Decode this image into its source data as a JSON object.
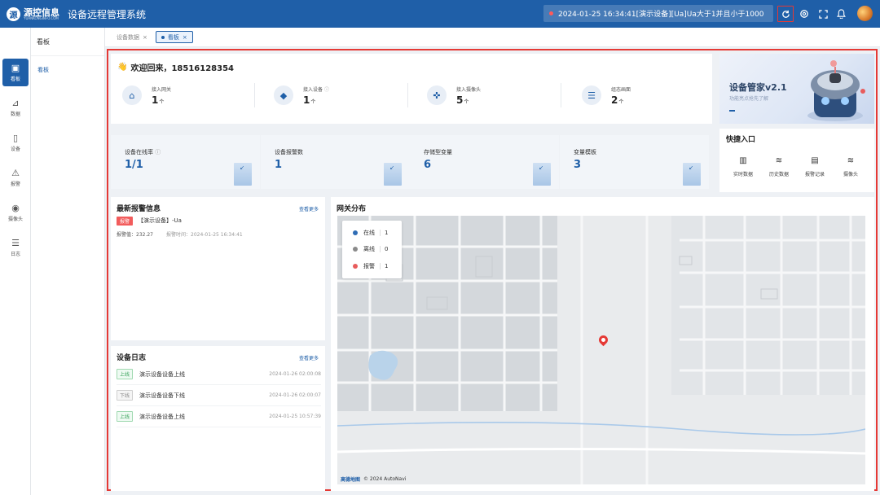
{
  "header": {
    "logo_mark": "源",
    "logo_main": "源控信息",
    "logo_sub": "YUANKONGINFO.COM",
    "app_title": "设备远程管理系统",
    "alarm_ticker": "2024-01-25 16:34:41[演示设备][Ua]Ua大于1并且小于1000",
    "icons": [
      "refresh-icon",
      "settings-icon",
      "fullscreen-icon",
      "bell-icon"
    ]
  },
  "sidebar": {
    "items": [
      {
        "label": "看板",
        "icon": "dashboard-icon",
        "active": true
      },
      {
        "label": "数据",
        "icon": "chart-icon"
      },
      {
        "label": "设备",
        "icon": "device-icon"
      },
      {
        "label": "报警",
        "icon": "alarm-icon"
      },
      {
        "label": "摄像头",
        "icon": "camera-icon"
      },
      {
        "label": "日志",
        "icon": "log-icon"
      }
    ]
  },
  "subnav": {
    "title": "看板",
    "items": [
      "看板"
    ]
  },
  "tabs": [
    {
      "label": "设备数据"
    },
    {
      "label": "看板",
      "active": true
    }
  ],
  "welcome": {
    "title": "欢迎回来，18516128354",
    "stats": [
      {
        "label": "接入网关",
        "value": "1",
        "unit": "个"
      },
      {
        "label": "接入设备",
        "value": "1",
        "unit": "个"
      },
      {
        "label": "接入摄像头",
        "value": "5",
        "unit": "个"
      },
      {
        "label": "组态画面",
        "value": "2",
        "unit": "个"
      }
    ]
  },
  "banner": {
    "title": "设备管家v2.1",
    "subtitle": "功能亮点抢先了解"
  },
  "kpis": [
    {
      "label": "设备在线率",
      "value": "1/1"
    },
    {
      "label": "设备报警数",
      "value": "1"
    },
    {
      "label": "存储型变量",
      "value": "6"
    },
    {
      "label": "变量模板",
      "value": "3"
    }
  ],
  "quick_entry": {
    "title": "快捷入口",
    "items": [
      {
        "label": "实时数据",
        "icon": "bar-chart-icon"
      },
      {
        "label": "历史数据",
        "icon": "layers-icon"
      },
      {
        "label": "报警记录",
        "icon": "report-icon"
      },
      {
        "label": "摄像头",
        "icon": "layers-icon"
      }
    ]
  },
  "alarms": {
    "title": "最新报警信息",
    "more": "查看更多",
    "items": [
      {
        "badge": "报警",
        "device": "【演示设备】-Ua",
        "value_text": "报警值：232.27",
        "time_text": "报警时间：2024-01-25 16:34:41"
      }
    ]
  },
  "logs": {
    "title": "设备日志",
    "more": "查看更多",
    "items": [
      {
        "status": "上线",
        "message": "演示设备设备上线",
        "time": "2024-01-26 02:00:08",
        "type": "online"
      },
      {
        "status": "下线",
        "message": "演示设备设备下线",
        "time": "2024-01-26 02:00:07",
        "type": "offline"
      },
      {
        "status": "上线",
        "message": "演示设备设备上线",
        "time": "2024-01-25 10:57:39",
        "type": "online"
      }
    ]
  },
  "map": {
    "title": "网关分布",
    "legend": [
      {
        "label": "在线",
        "count": "1",
        "color": "#2f6db5"
      },
      {
        "label": "离线",
        "count": "0",
        "color": "#8a8a8a"
      },
      {
        "label": "报警",
        "count": "1",
        "color": "#e85c5c"
      }
    ],
    "attribution": "© 2024 AutoNavi",
    "provider": "高德地图"
  }
}
